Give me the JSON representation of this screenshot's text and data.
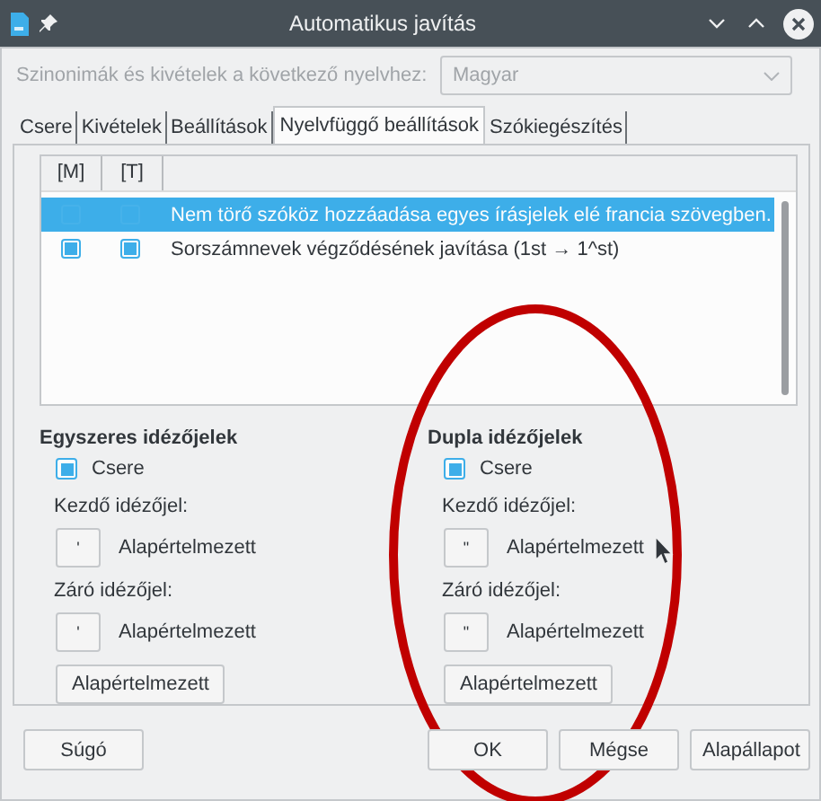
{
  "window": {
    "title": "Automatikus javítás"
  },
  "language": {
    "label": "Szinonimák és kivételek a következő nyelvhez:",
    "value": "Magyar",
    "disabled": true
  },
  "tabs": [
    {
      "label": "Csere",
      "selected": false
    },
    {
      "label": "Kivételek",
      "selected": false
    },
    {
      "label": "Beállítások",
      "selected": false
    },
    {
      "label": "Nyelvfüggő beállítások",
      "selected": true
    },
    {
      "label": "Szókiegészítés",
      "selected": false
    }
  ],
  "options": {
    "columns": [
      "[M]",
      "[T]"
    ],
    "rows": [
      {
        "text": "Nem törő szóköz hozzáadása egyes írásjelek elé francia szövegben.",
        "m": false,
        "t": false,
        "selected": true
      },
      {
        "text": "Sorszámnevek végződésének javítása (1st → 1^st)",
        "m": true,
        "t": true,
        "selected": false
      }
    ]
  },
  "quote_groups": [
    {
      "title": "Egyszeres idézőjelek",
      "replace": {
        "label": "Csere",
        "checked": true
      },
      "start": {
        "label": "Kezdő idézőjel:",
        "char": "'",
        "value": "Alapértelmezett"
      },
      "end": {
        "label": "Záró idézőjel:",
        "char": "'",
        "value": "Alapértelmezett"
      },
      "default_button": "Alapértelmezett"
    },
    {
      "title": "Dupla idézőjelek",
      "replace": {
        "label": "Csere",
        "checked": true
      },
      "start": {
        "label": "Kezdő idézőjel:",
        "char": "\"",
        "value": "Alapértelmezett"
      },
      "end": {
        "label": "Záró idézőjel:",
        "char": "\"",
        "value": "Alapértelmezett"
      },
      "default_button": "Alapértelmezett"
    }
  ],
  "buttons": [
    {
      "label": "Súgó",
      "kind": "help"
    },
    {
      "label": "OK",
      "kind": "action"
    },
    {
      "label": "Mégse",
      "kind": "action"
    },
    {
      "label": "Alapállapot",
      "kind": "action"
    }
  ]
}
